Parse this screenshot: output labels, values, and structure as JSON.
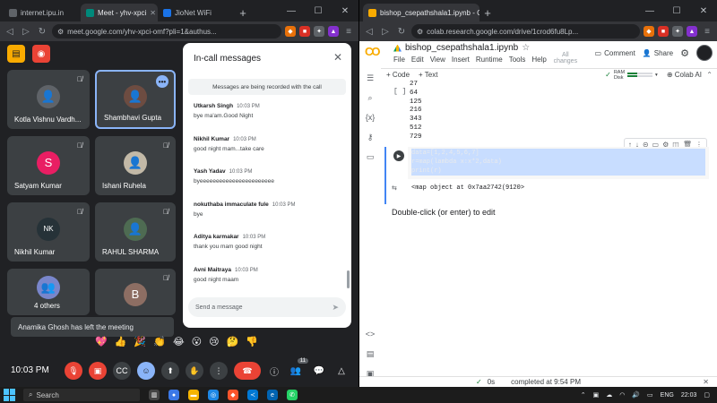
{
  "left_window": {
    "tabs": [
      {
        "label": "internet.ipu.in"
      },
      {
        "label": "Meet - yhv-xpci"
      },
      {
        "label": "JioNet WiFi"
      }
    ],
    "url": "meet.google.com/yhv-xpci-omf?pli=1&authus...",
    "participants": [
      {
        "name": "Kotla Vishnu Vardh...",
        "initial": ""
      },
      {
        "name": "Shambhavi Gupta",
        "initial": ""
      },
      {
        "name": "Satyam Kumar",
        "initial": "S"
      },
      {
        "name": "Ishani Ruhela",
        "initial": ""
      },
      {
        "name": "Nikhil Kumar",
        "initial": ""
      },
      {
        "name": "RAHUL SHARMA",
        "initial": ""
      },
      {
        "name": "4 others",
        "initial": ""
      },
      {
        "name": "",
        "initial": "B"
      }
    ],
    "toast": "Anamika Ghosh has left the meeting",
    "clock": "10:03 PM",
    "people_count": "11",
    "chat": {
      "title": "In-call messages",
      "notice": "Messages are being recorded with the call",
      "messages": [
        {
          "who": "Utkarsh Singh",
          "when": "10:03 PM",
          "text": "bye ma'am.Good Night"
        },
        {
          "who": "Nikhil Kumar",
          "when": "10:03 PM",
          "text": "good night mam...take care"
        },
        {
          "who": "Yash Yadav",
          "when": "10:03 PM",
          "text": "byeeeeeeeeeeeeeeeeeeeeeee"
        },
        {
          "who": "nokuthaba immaculate fule",
          "when": "10:03 PM",
          "text": "bye"
        },
        {
          "who": "Aditya karmakar",
          "when": "10:03 PM",
          "text": "thank you mam good night"
        },
        {
          "who": "Avni Maitraya",
          "when": "10:03 PM",
          "text": "good night maam"
        }
      ],
      "input_placeholder": "Send a message"
    }
  },
  "right_window": {
    "tab": "bishop_csepathshala1.ipynb - Co",
    "url": "colab.research.google.com/drive/1crod6fu8Lp...",
    "notebook_title": "bishop_csepathshala1.ipynb",
    "menu": [
      "File",
      "Edit",
      "View",
      "Insert",
      "Runtime",
      "Tools",
      "Help"
    ],
    "all_changes": "All changes",
    "comment": "Comment",
    "share": "Share",
    "add_code": "+ Code",
    "add_text": "+ Text",
    "ram_label": "RAM",
    "disk_label": "Disk",
    "colab_ai": "Colab AI",
    "prev_bracket": "[ ]",
    "prev_output": [
      "27",
      "64",
      "125",
      "216",
      "343",
      "512",
      "729"
    ],
    "code_lines": [
      "data=[1,2,4,5,6,7]",
      "r=map(lambda x:x*2,data)",
      "print(r)"
    ],
    "cell_output": "<map object at 0x7aa2742(9120>",
    "md_placeholder": "Double-click (or enter) to edit",
    "status_time": "0s",
    "status_done": "completed at 9:54 PM"
  },
  "taskbar": {
    "search": "Search",
    "lang": "ENG",
    "time": "22:03"
  }
}
